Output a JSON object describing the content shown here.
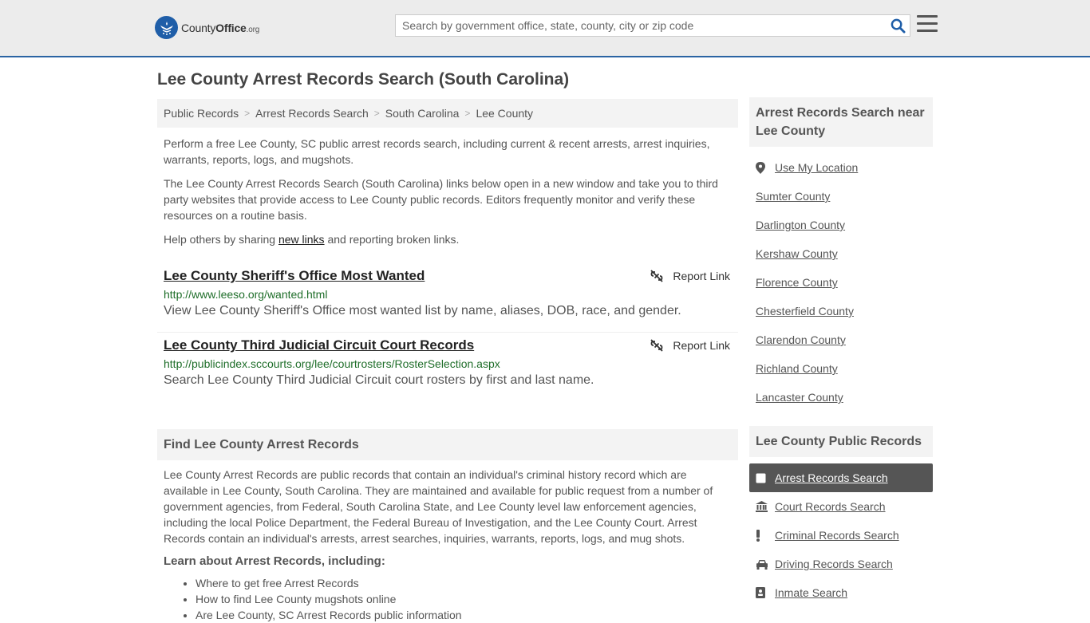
{
  "header": {
    "logo_county": "County",
    "logo_office": "Office",
    "logo_tld": ".org",
    "search_placeholder": "Search by government office, state, county, city or zip code"
  },
  "page_title": "Lee County Arrest Records Search (South Carolina)",
  "breadcrumb": [
    "Public Records",
    "Arrest Records Search",
    "South Carolina",
    "Lee County"
  ],
  "intro": {
    "p1": "Perform a free Lee County, SC public arrest records search, including current & recent arrests, arrest inquiries, warrants, reports, logs, and mugshots.",
    "p2": "The Lee County Arrest Records Search (South Carolina) links below open in a new window and take you to third party websites that provide access to Lee County public records. Editors frequently monitor and verify these resources on a routine basis.",
    "p3_pre": "Help others by sharing ",
    "p3_link": "new links",
    "p3_post": " and reporting broken links."
  },
  "links": [
    {
      "title": "Lee County Sheriff's Office Most Wanted",
      "url": "http://www.leeso.org/wanted.html",
      "desc": "View Lee County Sheriff's Office most wanted list by name, aliases, DOB, race, and gender.",
      "report": "Report Link"
    },
    {
      "title": "Lee County Third Judicial Circuit Court Records",
      "url": "http://publicindex.sccourts.org/lee/courtrosters/RosterSelection.aspx",
      "desc": "Search Lee County Third Judicial Circuit court rosters by first and last name.",
      "report": "Report Link"
    }
  ],
  "find": {
    "heading": "Find Lee County Arrest Records",
    "body": "Lee County Arrest Records are public records that contain an individual's criminal history record which are available in Lee County, South Carolina. They are maintained and available for public request from a number of government agencies, from Federal, South Carolina State, and Lee County level law enforcement agencies, including the local Police Department, the Federal Bureau of Investigation, and the Lee County Court. Arrest Records contain an individual's arrests, arrest searches, inquiries, warrants, reports, logs, and mug shots.",
    "learn_heading": "Learn about Arrest Records, including:",
    "learn_items": [
      "Where to get free Arrest Records",
      "How to find Lee County mugshots online",
      "Are Lee County, SC Arrest Records public information"
    ]
  },
  "sidebar": {
    "near_heading": "Arrest Records Search near Lee County",
    "use_location": "Use My Location",
    "counties": [
      "Sumter County",
      "Darlington County",
      "Kershaw County",
      "Florence County",
      "Chesterfield County",
      "Clarendon County",
      "Richland County",
      "Lancaster County"
    ],
    "public_heading": "Lee County Public Records",
    "public_items": [
      {
        "label": "Arrest Records Search",
        "icon": "square-icon"
      },
      {
        "label": "Court Records Search",
        "icon": "courthouse-icon"
      },
      {
        "label": "Criminal Records Search",
        "icon": "exclamation-icon"
      },
      {
        "label": "Driving Records Search",
        "icon": "car-icon"
      },
      {
        "label": "Inmate Search",
        "icon": "id-badge-icon"
      }
    ]
  }
}
